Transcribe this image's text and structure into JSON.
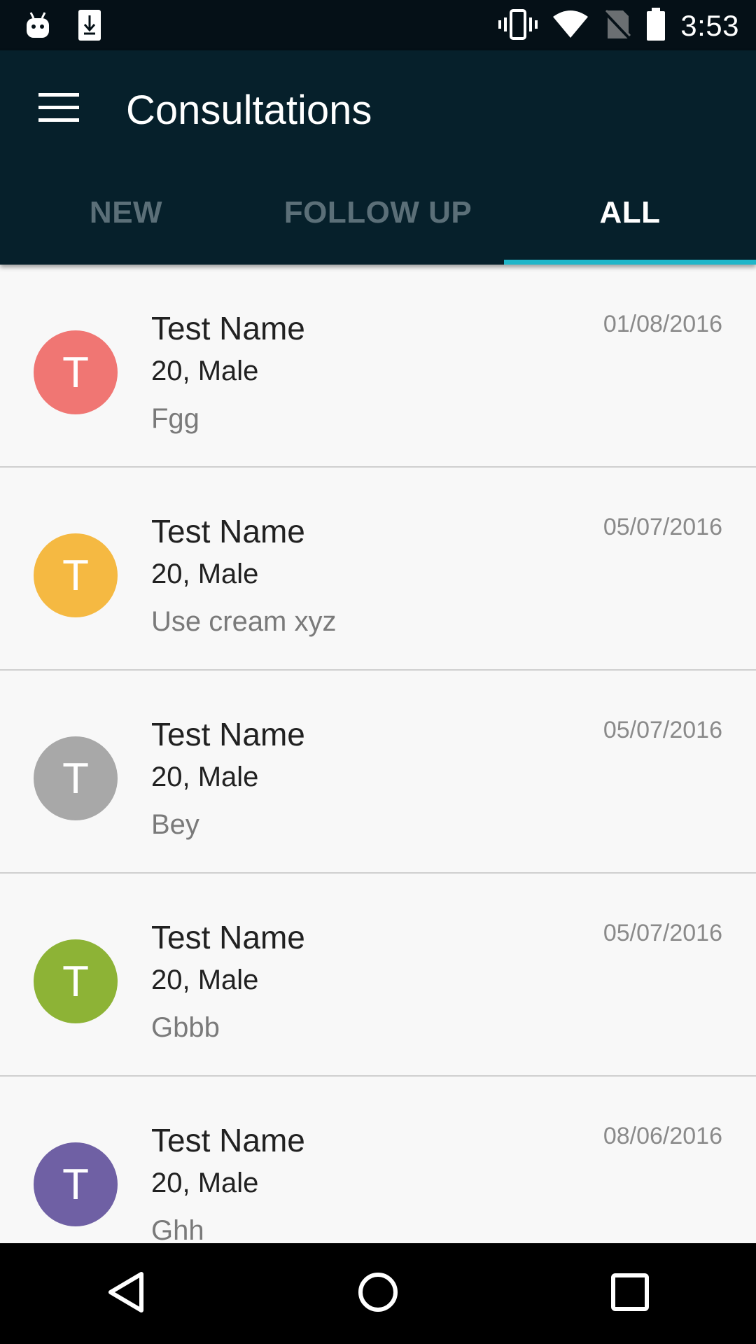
{
  "status_bar": {
    "time": "3:53",
    "left_icons": [
      "android-icon",
      "download-icon"
    ],
    "right_icons": [
      "vibrate-icon",
      "wifi-icon",
      "no-sim-icon",
      "battery-icon"
    ]
  },
  "header": {
    "title": "Consultations",
    "menu_icon": "hamburger-menu-icon"
  },
  "tabs": [
    {
      "label": "NEW",
      "active": false
    },
    {
      "label": "FOLLOW UP",
      "active": false
    },
    {
      "label": "ALL",
      "active": true
    }
  ],
  "colors": {
    "status_bar": "#051017",
    "app_bar": "#06202b",
    "tab_indicator": "#1fb6c9",
    "avatar_red": "#f07673",
    "avatar_yellow": "#f5b942",
    "avatar_gray": "#a8a8a8",
    "avatar_green": "#8db336",
    "avatar_purple": "#6f60a4"
  },
  "consultations": [
    {
      "initial": "T",
      "name": "Test Name",
      "info": "20, Male",
      "note": "Fgg",
      "date": "01/08/2016",
      "color": "#f07673"
    },
    {
      "initial": "T",
      "name": "Test Name",
      "info": "20, Male",
      "note": "Use cream xyz",
      "date": "05/07/2016",
      "color": "#f5b942"
    },
    {
      "initial": "T",
      "name": "Test Name",
      "info": "20, Male",
      "note": "Bey",
      "date": "05/07/2016",
      "color": "#a8a8a8"
    },
    {
      "initial": "T",
      "name": "Test Name",
      "info": "20, Male",
      "note": "Gbbb",
      "date": "05/07/2016",
      "color": "#8db336"
    },
    {
      "initial": "T",
      "name": "Test Name",
      "info": "20, Male",
      "note": "Ghh",
      "date": "08/06/2016",
      "color": "#6f60a4"
    }
  ],
  "nav_bar": {
    "icons": [
      "back-icon",
      "home-icon",
      "recents-icon"
    ]
  }
}
